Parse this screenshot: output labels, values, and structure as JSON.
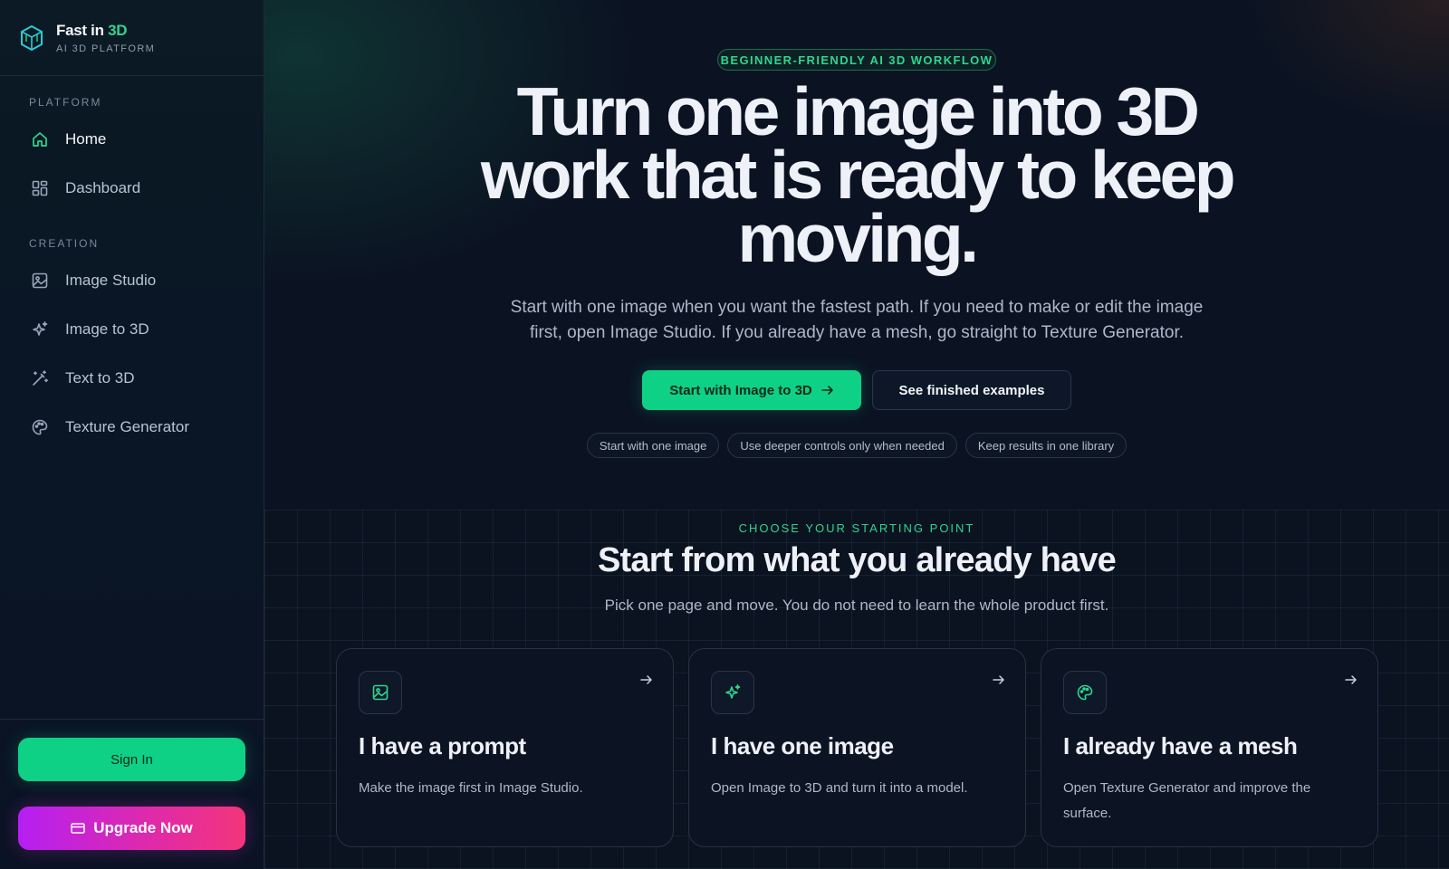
{
  "brand": {
    "name_prefix": "Fast in ",
    "name_accent": "3D",
    "subtitle": "AI 3D PLATFORM"
  },
  "sidebar": {
    "sections": [
      {
        "label": "PLATFORM"
      },
      {
        "label": "CREATION"
      }
    ],
    "items": [
      {
        "label": "Home",
        "icon": "home-icon"
      },
      {
        "label": "Dashboard",
        "icon": "dashboard-icon"
      },
      {
        "label": "Image Studio",
        "icon": "image-icon"
      },
      {
        "label": "Image to 3D",
        "icon": "sparkles-icon"
      },
      {
        "label": "Text to 3D",
        "icon": "wand-icon"
      },
      {
        "label": "Texture Generator",
        "icon": "palette-icon"
      }
    ],
    "active": "Home",
    "sign_in": "Sign In",
    "upgrade": "Upgrade Now"
  },
  "hero": {
    "badge": "BEGINNER-FRIENDLY AI 3D WORKFLOW",
    "title": "Turn one image into 3D work that is ready to keep moving.",
    "subtitle": "Start with one image when you want the fastest path. If you need to make or edit the image first, open Image Studio. If you already have a mesh, go straight to Texture Generator.",
    "primary_cta": "Start with Image to 3D",
    "secondary_cta": "See finished examples",
    "chips": [
      "Start with one image",
      "Use deeper controls only when needed",
      "Keep results in one library"
    ]
  },
  "section": {
    "eyebrow": "CHOOSE YOUR STARTING POINT",
    "title": "Start from what you already have",
    "subtitle": "Pick one page and move. You do not need to learn the whole product first.",
    "cards": [
      {
        "title": "I have a prompt",
        "desc": "Make the image first in Image Studio.",
        "icon": "image-icon"
      },
      {
        "title": "I have one image",
        "desc": "Open Image to 3D and turn it into a model.",
        "icon": "sparkles-icon"
      },
      {
        "title": "I already have a mesh",
        "desc": "Open Texture Generator and improve the surface.",
        "icon": "palette-icon"
      }
    ]
  },
  "colors": {
    "accent": "#0fd186",
    "accent_text": "#2fd58f",
    "background": "#0a1120",
    "upgrade_start": "#b51ff3",
    "upgrade_end": "#f3357a"
  }
}
